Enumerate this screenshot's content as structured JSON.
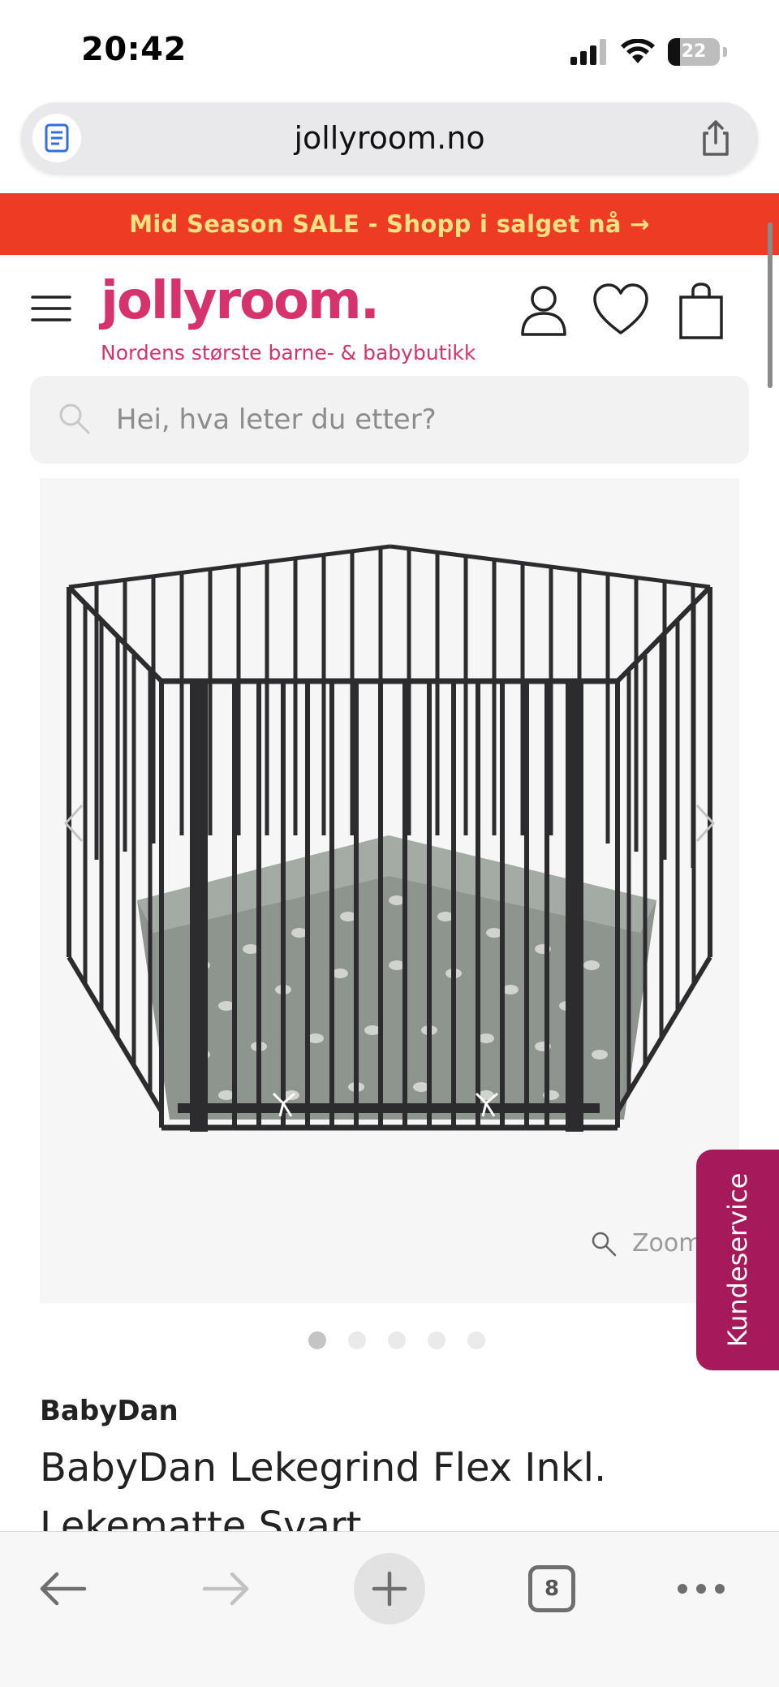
{
  "status_bar": {
    "time": "20:42",
    "battery_level": "22",
    "icons": [
      "cellular-signal-icon",
      "wifi-icon",
      "battery-icon"
    ]
  },
  "browser": {
    "url": "jollyroom.no",
    "reader_icon": "reader-mode-icon",
    "share_icon": "share-icon"
  },
  "promo": {
    "text": "Mid Season SALE - Shopp i salget nå →",
    "background": "#ee3b23",
    "color": "#ffe082"
  },
  "header": {
    "logo": "jollyroom.",
    "tagline": "Nordens største barne- & babybutikk",
    "brand_color": "#d6336c",
    "icons": [
      "menu-icon",
      "user-icon",
      "heart-icon",
      "cart-icon"
    ]
  },
  "search": {
    "placeholder": "Hei, hva leter du etter?"
  },
  "gallery": {
    "zoom_label": "Zoom",
    "total_images": 5,
    "active_index": 0
  },
  "support_tab": {
    "label": "Kundeservice",
    "color": "#a6195a"
  },
  "product": {
    "brand": "BabyDan",
    "title": "BabyDan Lekegrind Flex Inkl. Lekematte Svart"
  },
  "toolbar": {
    "tabs_count": "8",
    "icons": [
      "back-arrow-icon",
      "forward-arrow-icon",
      "new-tab-plus-icon",
      "tabs-icon",
      "more-icon"
    ]
  }
}
